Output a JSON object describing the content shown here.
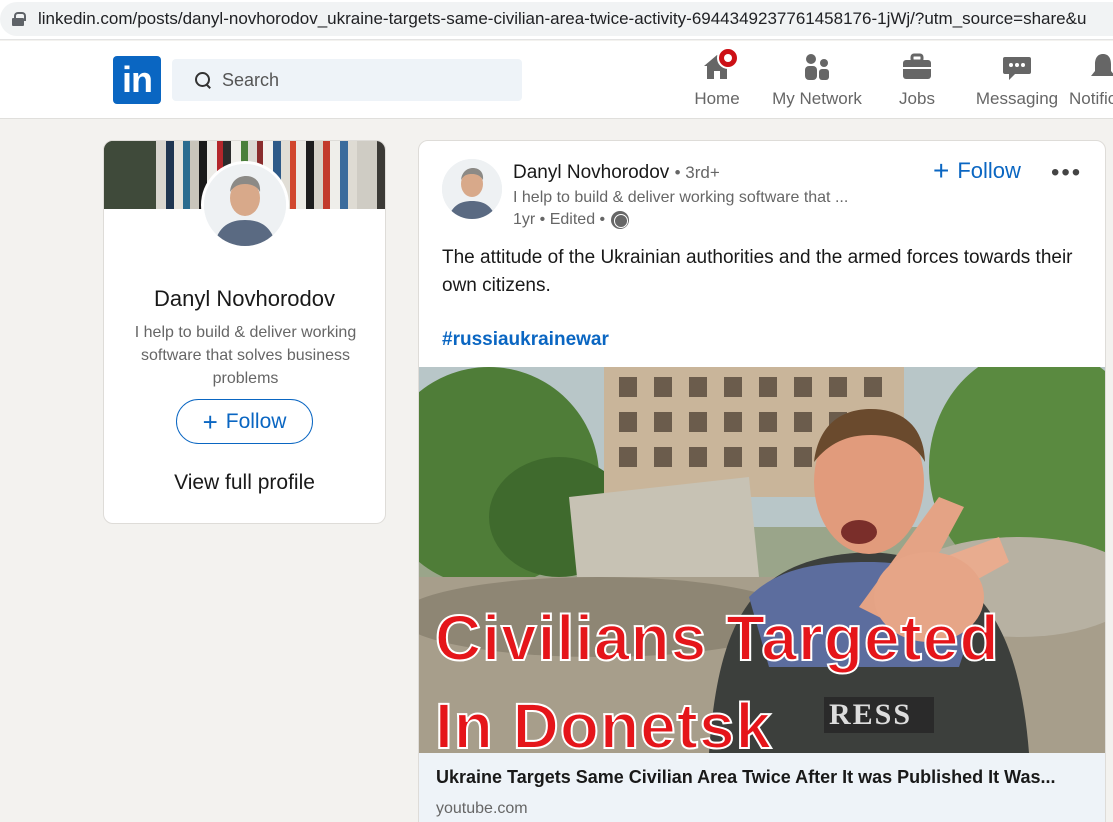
{
  "browser": {
    "url": "linkedin.com/posts/danyl-novhorodov_ukraine-targets-same-civilian-area-twice-activity-6944349237761458176-1jWj/?utm_source=share&u"
  },
  "nav": {
    "logo": "in",
    "search_placeholder": "Search",
    "items": [
      {
        "label": "Home",
        "icon": "home-icon"
      },
      {
        "label": "My Network",
        "icon": "network-icon"
      },
      {
        "label": "Jobs",
        "icon": "briefcase-icon"
      },
      {
        "label": "Messaging",
        "icon": "messaging-icon"
      },
      {
        "label": "Notific",
        "icon": "bell-icon"
      }
    ]
  },
  "profile_card": {
    "name": "Danyl Novhorodov",
    "headline": "I help to build & deliver working software that solves business problems",
    "follow_label": "Follow",
    "view_profile": "View full profile"
  },
  "post": {
    "author": "Danyl Novhorodov",
    "degree": "• 3rd+",
    "headline": "I help to build & deliver working software that ...",
    "meta": "1yr • Edited •",
    "follow_label": "Follow",
    "more": "•••",
    "text": "The attitude of the Ukrainian authorities and the armed forces towards their own citizens.",
    "hashtag": "#russiaukrainewar",
    "media": {
      "caption_line1": "Civilians Targeted",
      "caption_line2": "In Donetsk",
      "vest_text": "RESS"
    },
    "link": {
      "title": "Ukraine Targets Same Civilian Area Twice After It was Published It Was...",
      "source": "youtube.com"
    }
  },
  "colors": {
    "brand": "#0a66c2",
    "notification": "#cc1016",
    "caption_red": "#e5151a"
  }
}
